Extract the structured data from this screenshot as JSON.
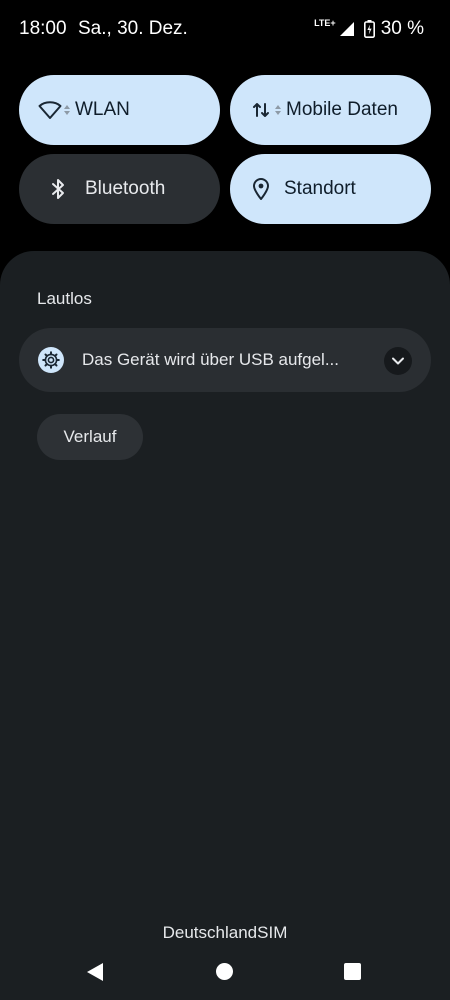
{
  "status_bar": {
    "time": "18:00",
    "date": "Sa., 30. Dez.",
    "network_type": "LTE+",
    "battery": "30 %",
    "icons": [
      "signal-icon",
      "battery-charging-icon"
    ]
  },
  "quick_settings": {
    "tiles": [
      {
        "label": "WLAN",
        "state": "on",
        "icon": "wifi-icon"
      },
      {
        "label": "Mobile Daten",
        "state": "on",
        "icon": "data-arrows-icon"
      },
      {
        "label": "Bluetooth",
        "state": "off",
        "icon": "bluetooth-icon"
      },
      {
        "label": "Standort",
        "state": "on",
        "icon": "location-pin-icon"
      }
    ]
  },
  "notifications": {
    "section_label": "Lautlos",
    "items": [
      {
        "text": "Das Gerät wird über USB aufgel...",
        "icon": "settings-gear-icon"
      }
    ],
    "history_button": "Verlauf"
  },
  "carrier": "DeutschlandSIM",
  "colors": {
    "tile_active": "#cfe6fb",
    "tile_inactive": "#2b2f33",
    "shade_background": "#1b1f22"
  }
}
